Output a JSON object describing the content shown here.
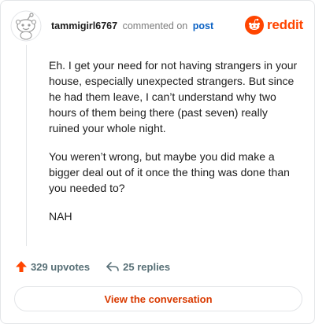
{
  "comment": {
    "author": "tammigirl6767",
    "commented_on": "commented on",
    "post_link": "post",
    "paragraphs": [
      "Eh. I get your need for not having strangers in your house, especially unexpected strangers. But since he had them leave, I can’t understand why two hours of them being there (past seven) really ruined your whole night.",
      "You weren’t wrong, but maybe you did make a bigger deal out of it once the thing was done than you needed to?",
      "NAH"
    ]
  },
  "brand": {
    "name": "reddit",
    "icon": "reddit-snoo-icon",
    "color": "#ff4500"
  },
  "actions": {
    "upvotes": "329 upvotes",
    "replies": "25 replies"
  },
  "cta": {
    "label": "View the conversation"
  },
  "colors": {
    "accent": "#ff4500",
    "link": "#0b62c4",
    "cta_text": "#d93a00",
    "muted": "#576f76"
  }
}
